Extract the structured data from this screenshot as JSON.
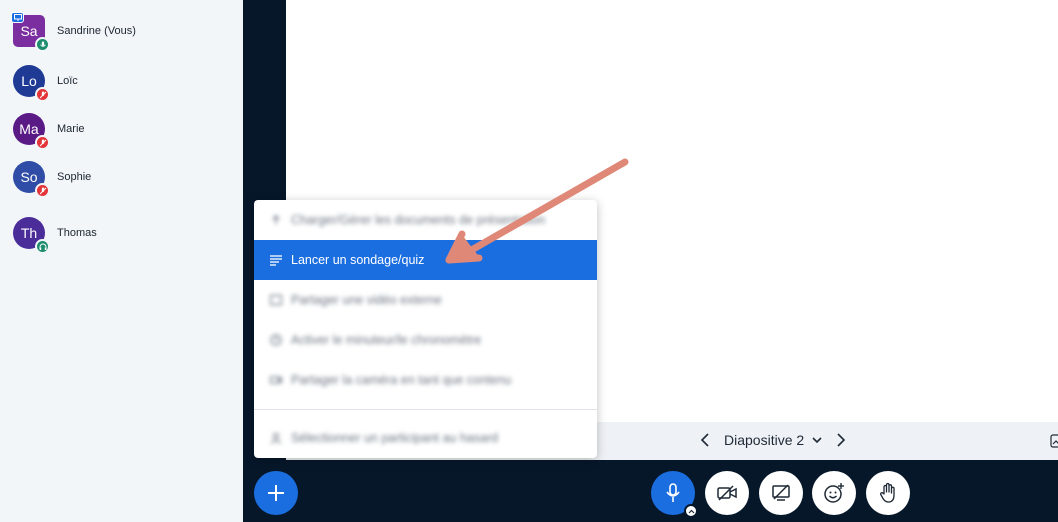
{
  "participants": [
    {
      "initials": "Sa",
      "name": "Sandrine (Vous)",
      "color": "#7a2e9f",
      "status": "mic-on",
      "presenter": true
    },
    {
      "initials": "Lo",
      "name": "Loïc",
      "color": "#1e3a94",
      "status": "mic-muted"
    },
    {
      "initials": "Ma",
      "name": "Marie",
      "color": "#5a1a86",
      "status": "mic-muted"
    },
    {
      "initials": "So",
      "name": "Sophie",
      "color": "#2f4da6",
      "status": "mic-muted"
    },
    {
      "initials": "Th",
      "name": "Thomas",
      "color": "#4b2d99",
      "status": "listen-only"
    }
  ],
  "slide": {
    "label": "Diapositive 2"
  },
  "menu": {
    "items": [
      {
        "label": "Charger/Gérer les documents de présentation",
        "icon": "upload-icon",
        "blurred": true
      },
      {
        "label": "Lancer un sondage/quiz",
        "icon": "poll-icon",
        "selected": true
      },
      {
        "label": "Partager une vidéo externe",
        "icon": "video-icon",
        "blurred": true
      },
      {
        "label": "Activer le minuteur/le chronomètre",
        "icon": "timer-icon",
        "blurred": true
      },
      {
        "label": "Partager la caméra en tant que contenu",
        "icon": "camera-icon",
        "blurred": true
      },
      {
        "label": "Sélectionner un participant au hasard",
        "icon": "user-icon",
        "blurred": true
      }
    ]
  },
  "colors": {
    "accent": "#1b6ee0",
    "muted": "#e3343a",
    "mic_on": "#1e8c6e",
    "arrow": "#e08878"
  }
}
